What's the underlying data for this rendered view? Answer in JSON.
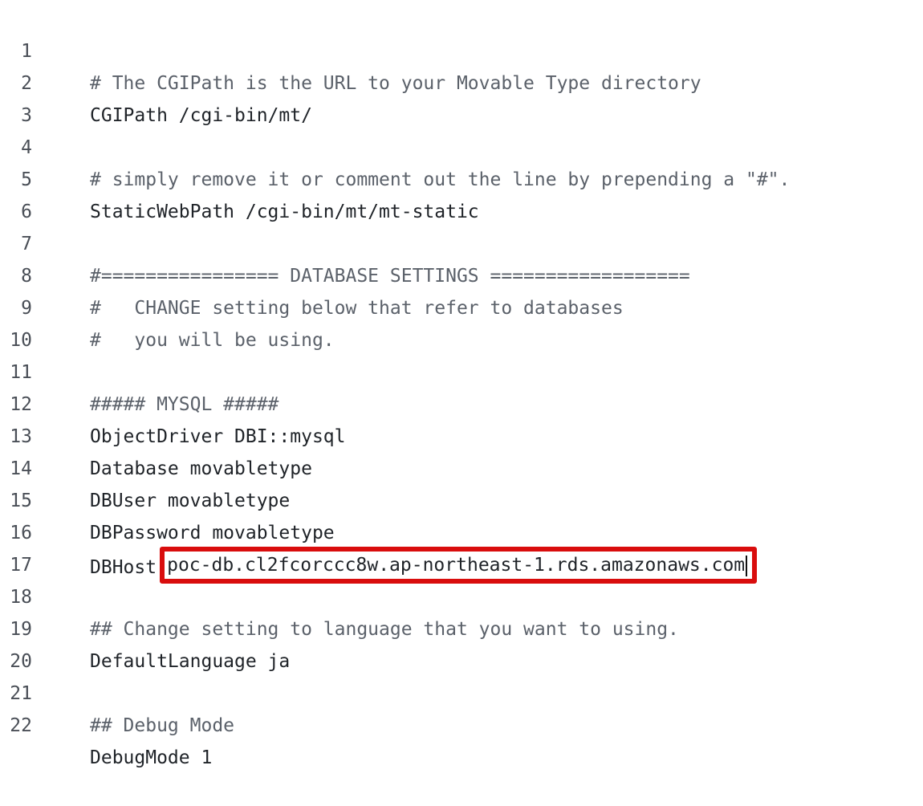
{
  "lines": [
    {
      "num": "1",
      "text": "# The CGIPath is the URL to your Movable Type directory"
    },
    {
      "num": "2",
      "text": "CGIPath /cgi-bin/mt/"
    },
    {
      "num": "3",
      "text": ""
    },
    {
      "num": "4",
      "text": "# simply remove it or comment out the line by prepending a \"#\"."
    },
    {
      "num": "5",
      "text": "StaticWebPath /cgi-bin/mt/mt-static"
    },
    {
      "num": "6",
      "text": ""
    },
    {
      "num": "7",
      "text": "#================ DATABASE SETTINGS =================="
    },
    {
      "num": "8",
      "text": "#   CHANGE setting below that refer to databases"
    },
    {
      "num": "9",
      "text": "#   you will be using."
    },
    {
      "num": "10",
      "text": ""
    },
    {
      "num": "11",
      "text": "##### MYSQL #####"
    },
    {
      "num": "12",
      "text": "ObjectDriver DBI::mysql"
    },
    {
      "num": "13",
      "text": "Database movabletype"
    },
    {
      "num": "14",
      "text": "DBUser movabletype"
    },
    {
      "num": "15",
      "text": "DBPassword movabletype"
    },
    {
      "num": "16",
      "text": "DBHost"
    },
    {
      "num": "17",
      "text": ""
    },
    {
      "num": "18",
      "text": "## Change setting to language that you want to using."
    },
    {
      "num": "19",
      "text": "DefaultLanguage ja"
    },
    {
      "num": "20",
      "text": ""
    },
    {
      "num": "21",
      "text": "## Debug Mode"
    },
    {
      "num": "22",
      "text": "DebugMode 1"
    }
  ],
  "highlight": {
    "value": "poc-db.cl2fcorccc8w.ap-northeast-1.rds.amazonaws.com",
    "border_color": "#d90d0d"
  }
}
